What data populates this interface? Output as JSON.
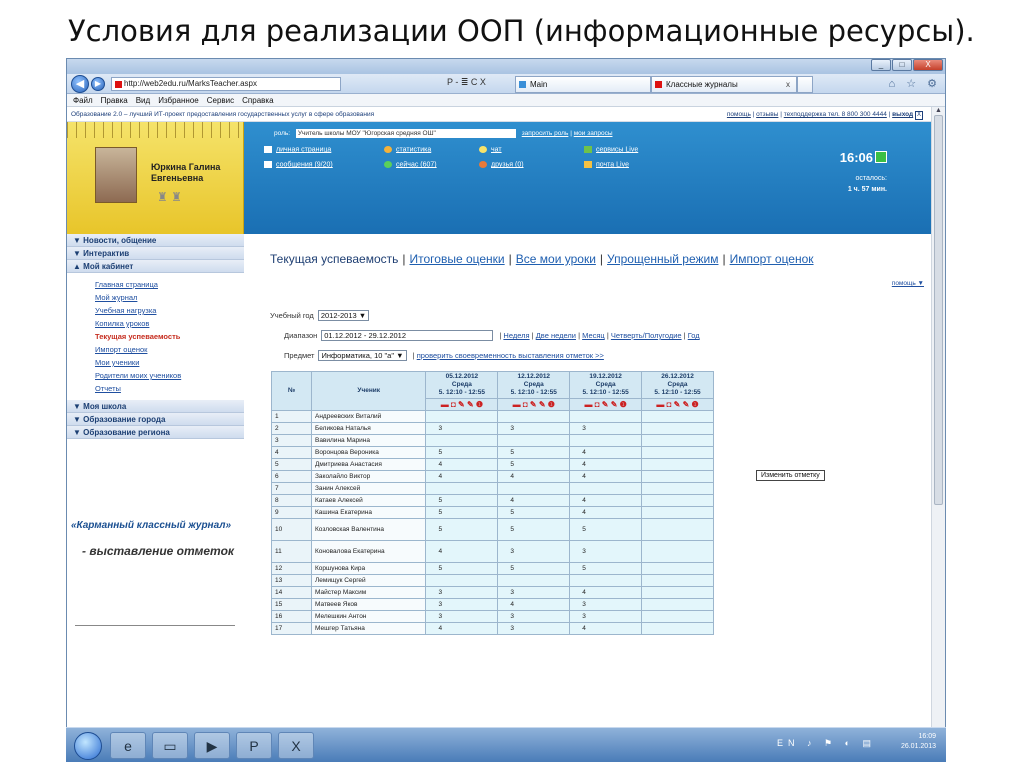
{
  "slide_title": "Условия для реализации ООП (информационные ресурсы).",
  "browser": {
    "url": "http://web2edu.ru/MarksTeacher.aspx",
    "url_controls": "P - ≣ C X",
    "tabs": [
      "Main",
      "Классные журналы"
    ],
    "tab_close": "x",
    "menu": [
      "Файл",
      "Правка",
      "Вид",
      "Избранное",
      "Сервис",
      "Справка"
    ],
    "window_buttons": [
      "_",
      "□",
      "X"
    ],
    "top_icons": "⌂ ☆ ⚙"
  },
  "site": {
    "top_left": "Образование 2.0 – лучший ИТ-проект предоставления государственных услуг в сфере образования",
    "top_links": [
      "помощь",
      "отзывы",
      "техподдержка тел. 8 800 300 4444",
      "выход"
    ],
    "close_glyph": "X",
    "separator": "|",
    "role_label": "роль:",
    "role_value": "Учитель школы МОУ \"Югорская средняя ОШ\"",
    "role_links": [
      "запросить роль",
      "мои запросы"
    ],
    "header_links": [
      "личная страница",
      "статистика",
      "чат",
      "сервисы Live",
      "сообщения (9/20)",
      "сейчас (607)",
      "друзья (0)",
      "почта Live"
    ],
    "clock": "16:06",
    "remaining_label": "осталось:",
    "remaining_value": "1 ч. 57 мин.",
    "user_name": "Юркина Галина Евгеньевна",
    "medals_glyph": "♜ ♜"
  },
  "sidebar": {
    "sections": [
      "Новости, общение",
      "Интерактив",
      "Мой кабинет"
    ],
    "items": [
      "Главная страница",
      "Мой журнал",
      "Учебная нагрузка",
      "Копилка уроков",
      "Текущая успеваемость",
      "Импорт оценок",
      "Мои ученики",
      "Родители моих учеников",
      "Отчеты"
    ],
    "sections_after": [
      "Моя школа",
      "Образование города",
      "Образование региона"
    ],
    "collapse_glyph": "▼",
    "expand_glyph": "▲",
    "promo_title": "«Карманный классный журнал»",
    "promo_subtitle": "- выставление отметок"
  },
  "content": {
    "tabs": [
      "Текущая успеваемость",
      "Итоговые оценки",
      "Все мои уроки",
      "Упрощенный режим",
      "Импорт оценок"
    ],
    "help": "помощь ▼",
    "year_label": "Учебный год",
    "year_value": "2012-2013",
    "range_label": "Диапазон",
    "range_value": "01.12.2012 - 29.12.2012",
    "range_links": [
      "Неделя",
      "Две недели",
      "Месяц",
      "Четверть/Полугодие",
      "Год"
    ],
    "subject_label": "Предмет",
    "subject_value": "Информатика, 10 \"а\"",
    "check_link": "проверить своевременность выставления отметок >>",
    "dropdown_glyph": "▼",
    "tooltip": "Изменить отметку"
  },
  "table": {
    "headers": [
      "№",
      "Ученик"
    ],
    "dates": [
      {
        "date": "05.12.2012",
        "day": "Среда",
        "time": "5. 12:10 - 12:55"
      },
      {
        "date": "12.12.2012",
        "day": "Среда",
        "time": "5. 12:10 - 12:55"
      },
      {
        "date": "19.12.2012",
        "day": "Среда",
        "time": "5. 12:10 - 12:55"
      },
      {
        "date": "26.12.2012",
        "day": "Среда",
        "time": "5. 12:10 - 12:55"
      }
    ],
    "icons_glyph": "▬ ◘ ✎ ✎ ❶",
    "rows": [
      {
        "n": "1",
        "name": "Андреевских Виталий",
        "m": [
          "",
          "",
          "",
          ""
        ]
      },
      {
        "n": "2",
        "name": "Беликова Наталья",
        "m": [
          "3",
          "3",
          "3",
          ""
        ]
      },
      {
        "n": "3",
        "name": "Вавилина Марина",
        "m": [
          "",
          "",
          "",
          ""
        ]
      },
      {
        "n": "4",
        "name": "Воронцова Вероника",
        "m": [
          "5",
          "5",
          "4",
          ""
        ]
      },
      {
        "n": "5",
        "name": "Дмитриева Анастасия",
        "m": [
          "4",
          "5",
          "4",
          ""
        ]
      },
      {
        "n": "6",
        "name": "Заколайло Виктор",
        "m": [
          "4",
          "4",
          "4",
          ""
        ]
      },
      {
        "n": "7",
        "name": "Занин Алексей",
        "m": [
          "",
          "",
          "",
          ""
        ]
      },
      {
        "n": "8",
        "name": "Катаев Алексей",
        "m": [
          "5",
          "4",
          "4",
          ""
        ]
      },
      {
        "n": "9",
        "name": "Кашина Екатерина",
        "m": [
          "5",
          "5",
          "4",
          ""
        ]
      },
      {
        "n": "10",
        "name": "Козловская Валентина",
        "m": [
          "5",
          "5",
          "5",
          ""
        ]
      },
      {
        "n": "11",
        "name": "Коновалова Екатерина",
        "m": [
          "4",
          "3",
          "3",
          ""
        ]
      },
      {
        "n": "12",
        "name": "Коршунова Кира",
        "m": [
          "5",
          "5",
          "5",
          ""
        ]
      },
      {
        "n": "13",
        "name": "Лемищук Сергей",
        "m": [
          "",
          "",
          "",
          ""
        ]
      },
      {
        "n": "14",
        "name": "Майстер Максим",
        "m": [
          "3",
          "3",
          "4",
          ""
        ]
      },
      {
        "n": "15",
        "name": "Матвеев Яков",
        "m": [
          "3",
          "4",
          "3",
          ""
        ]
      },
      {
        "n": "16",
        "name": "Мелешкин Антон",
        "m": [
          "3",
          "3",
          "3",
          ""
        ]
      },
      {
        "n": "17",
        "name": "Мешгер Татьяна",
        "m": [
          "4",
          "3",
          "4",
          ""
        ]
      }
    ]
  },
  "taskbar": {
    "lang": "EN",
    "time": "16:09",
    "date": "26.01.2013",
    "tray_icons": "♪ ⚑ ◐ ▤"
  }
}
